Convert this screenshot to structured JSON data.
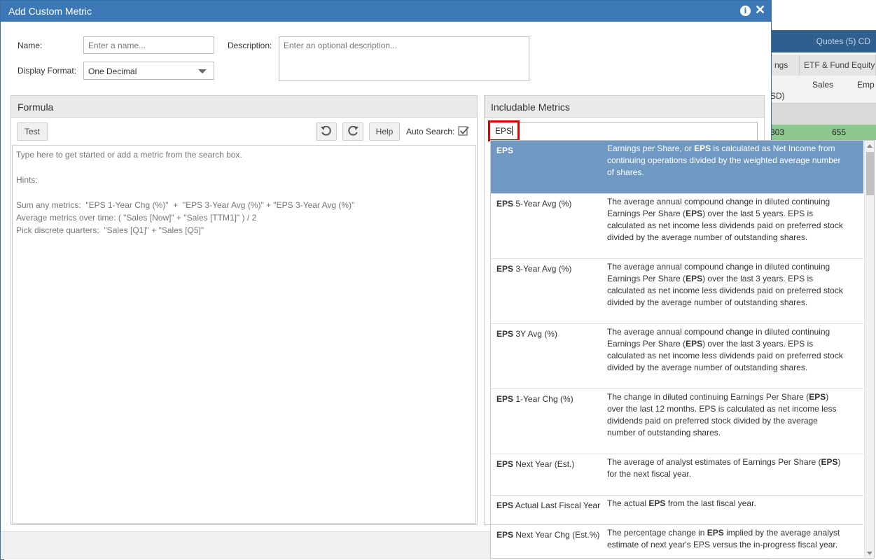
{
  "background": {
    "topbar_text": "Quotes (5) CD",
    "tabs": [
      "ngs",
      "ETF & Fund Equity"
    ],
    "headers": [
      "SD)",
      "Sales",
      "Emp"
    ],
    "green_row": [
      "303",
      "655"
    ]
  },
  "dialog": {
    "title": "Add Custom Metric",
    "name_label": "Name:",
    "name_placeholder": "Enter a name...",
    "display_format_label": "Display Format:",
    "display_format_value": "One Decimal",
    "description_label": "Description:",
    "description_placeholder": "Enter an optional description..."
  },
  "formula": {
    "title": "Formula",
    "test_label": "Test",
    "help_label": "Help",
    "auto_search_label": "Auto Search:",
    "auto_search_checked": true,
    "text": "Type here to get started or add a metric from the search box.\n\nHints:\n\nSum any metrics:  \"EPS 1-Year Chg (%)\"  +  \"EPS 3-Year Avg (%)\" + \"EPS 3-Year Avg (%)\"\nAverage metrics over time: ( \"Sales [Now]\" + \"Sales [TTM1]\" ) / 2\nPick discrete quarters:  \"Sales [Q1]\" + \"Sales [Q5]\""
  },
  "metrics": {
    "title": "Includable Metrics",
    "search_value": "EPS",
    "results": [
      {
        "bold": "EPS",
        "rest": "",
        "selected": true,
        "height": 76,
        "desc": [
          [
            "Earnings per Share, or ",
            false
          ],
          [
            "EPS",
            true
          ],
          [
            " is calculated as Net Income from continuing operations divided by the weighted average number of shares.",
            false
          ]
        ]
      },
      {
        "bold": "EPS",
        "rest": " 5-Year Avg (%)",
        "selected": false,
        "height": 93,
        "desc": [
          [
            "The average annual compound change in diluted continuing Earnings Per Share (",
            false
          ],
          [
            "EPS",
            true
          ],
          [
            ") over the last 5 years. EPS is calculated as net income less dividends paid on preferred stock divided by the average number of outstanding shares.",
            false
          ]
        ]
      },
      {
        "bold": "EPS",
        "rest": " 3-Year Avg (%)",
        "selected": false,
        "height": 93,
        "desc": [
          [
            "The average annual compound change in diluted continuing Earnings Per Share (",
            false
          ],
          [
            "EPS",
            true
          ],
          [
            ") over the last 3 years. EPS is calculated as net income less dividends paid on preferred stock divided by the average number of outstanding shares.",
            false
          ]
        ]
      },
      {
        "bold": "EPS",
        "rest": " 3Y Avg (%)",
        "selected": false,
        "height": 93,
        "desc": [
          [
            "The average annual compound change in diluted continuing Earnings Per Share (",
            false
          ],
          [
            "EPS",
            true
          ],
          [
            ") over the last 3 years. EPS is calculated as net income less dividends paid on preferred stock divided by the average number of outstanding shares.",
            false
          ]
        ]
      },
      {
        "bold": "EPS",
        "rest": " 1-Year Chg (%)",
        "selected": false,
        "height": 93,
        "desc": [
          [
            "The change in diluted continuing Earnings Per Share (",
            false
          ],
          [
            "EPS",
            true
          ],
          [
            ") over the last 12 months. EPS is calculated as net income less dividends paid on preferred stock divided by the average number of outstanding shares.",
            false
          ]
        ]
      },
      {
        "bold": "EPS",
        "rest": " Next Year (Est.)",
        "selected": false,
        "height": 59,
        "desc": [
          [
            "The average of analyst estimates of Earnings Per Share (",
            false
          ],
          [
            "EPS",
            true
          ],
          [
            ") for the next fiscal year.",
            false
          ]
        ]
      },
      {
        "bold": "EPS",
        "rest": " Actual Last Fiscal Year",
        "selected": false,
        "height": 42,
        "desc": [
          [
            "The actual ",
            false
          ],
          [
            "EPS",
            true
          ],
          [
            " from the last fiscal year.",
            false
          ]
        ]
      },
      {
        "bold": "EPS",
        "rest": " Next Year Chg (Est.%)",
        "selected": false,
        "height": 59,
        "desc": [
          [
            "The percentage change in ",
            false
          ],
          [
            "EPS",
            true
          ],
          [
            " implied by the average analyst estimate of next year's EPS versus the in-progress fiscal year.",
            false
          ]
        ]
      }
    ]
  }
}
